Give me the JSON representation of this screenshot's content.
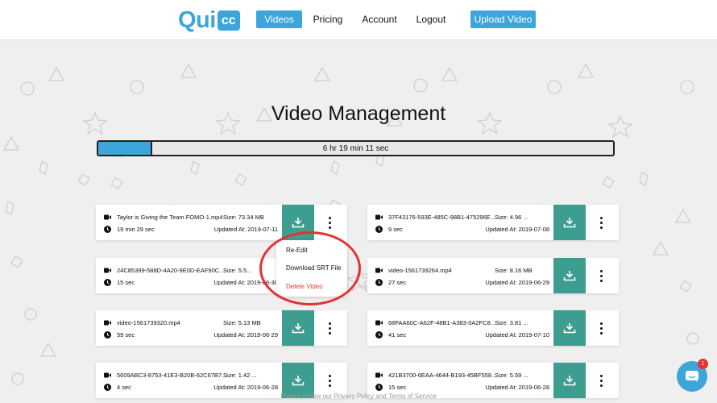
{
  "header": {
    "logo_main": "Qui",
    "logo_badge": "cc",
    "nav": [
      {
        "label": "Videos",
        "active": true
      },
      {
        "label": "Pricing",
        "active": false
      },
      {
        "label": "Account",
        "active": false
      },
      {
        "label": "Logout",
        "active": false
      }
    ],
    "upload_label": "Upload Video"
  },
  "page": {
    "title": "Video Management",
    "time_remaining": "6 hr 19 min 11 sec",
    "progress_fraction": 0.105
  },
  "videos": [
    {
      "name": "Taylor is Giving the Team FOMO-1.mp4",
      "duration": "19 min 29 sec",
      "size": "Size: 73.34 MB",
      "updated": "Updated At: 2019-07-11"
    },
    {
      "name": "37F43176-593E-485C-98B1-475296E27365...",
      "duration": "9 sec",
      "size": "Size: 4.96 ...",
      "updated": "Updated At: 2019-07-08"
    },
    {
      "name": "24C85399-588D-4A20-9E0D-EAF90C3A35...",
      "duration": "15 sec",
      "size": "Size: 5.5...",
      "updated": "Updated At: 2019-06-30"
    },
    {
      "name": "video-1561739264.mp4",
      "duration": "27 sec",
      "size": "Size: 8.16 MB",
      "updated": "Updated At: 2019-06-29"
    },
    {
      "name": "video-1561739320.mp4",
      "duration": "59 sec",
      "size": "Size: 5.13 MB",
      "updated": "Updated At: 2019-06-29"
    },
    {
      "name": "68FAA60C-A62F-48B1-A383-0A2FC8255A...",
      "duration": "41 sec",
      "size": "Size: 3.81 ...",
      "updated": "Updated At: 2019-07-10"
    },
    {
      "name": "5609ABC3-8753-41E3-B20B-62C67B7631B...",
      "duration": "4 sec",
      "size": "Size: 1.42 ...",
      "updated": "Updated At: 2019-06-28"
    },
    {
      "name": "421B3700-6EAA-4644-B193-45BF5581F471...",
      "duration": "15 sec",
      "size": "Size: 5.59 ...",
      "updated": "Updated At: 2019-06-28"
    }
  ],
  "context_menu": {
    "re_edit": "Re-Edit",
    "download_srt": "Download SRT File",
    "delete": "Delete Video"
  },
  "footer": "Please review our Privacy Policy and Terms of Service",
  "chat": {
    "badge_count": "1"
  },
  "colors": {
    "brand_blue": "#3da5d9",
    "download_green": "#3d9e8f",
    "delete_red": "#e23a3a",
    "highlight_red": "#e53232"
  }
}
